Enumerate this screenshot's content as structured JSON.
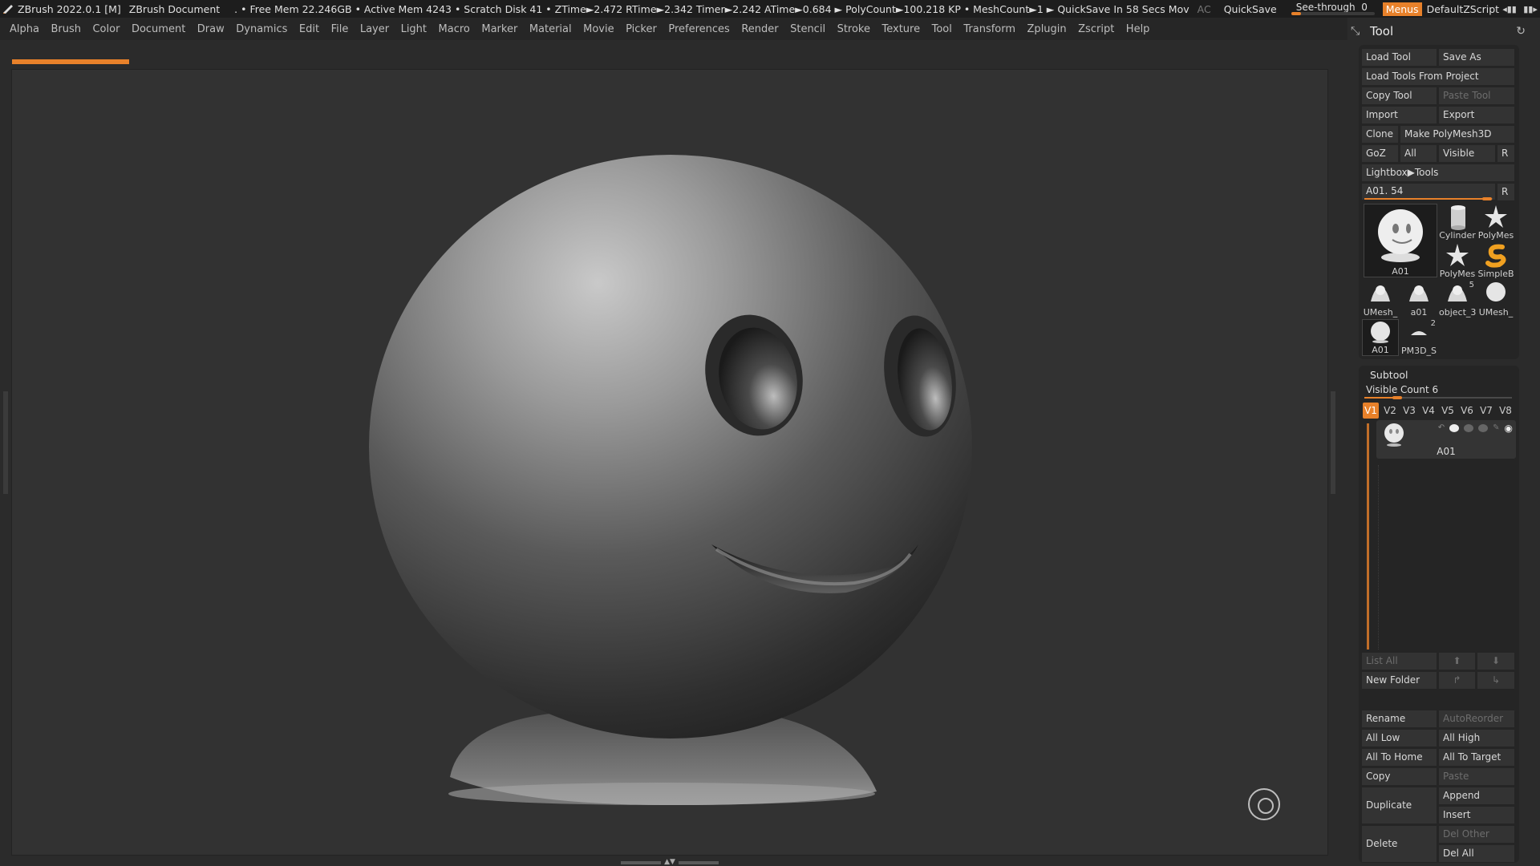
{
  "titlebar": {
    "app": "ZBrush 2022.0.1 [M]",
    "document": "ZBrush Document",
    "stats": ". • Free Mem 22.246GB • Active Mem 4243 • Scratch Disk 41 •  ZTime►2.472 RTime►2.342 Timer►2.242 ATime►0.684 ► PolyCount►100.218 KP  • MeshCount►1  ► QuickSave In 58 Secs Mov",
    "ac": "AC",
    "quicksave": "QuickSave",
    "seethrough_label": "See-through",
    "seethrough_value": "0",
    "menus": "Menus",
    "zscript": "DefaultZScript"
  },
  "menubar": {
    "items": [
      "Alpha",
      "Brush",
      "Color",
      "Document",
      "Draw",
      "Dynamics",
      "Edit",
      "File",
      "Layer",
      "Light",
      "Macro",
      "Marker",
      "Material",
      "Movie",
      "Picker",
      "Preferences",
      "Render",
      "Stencil",
      "Stroke",
      "Texture",
      "Tool",
      "Transform",
      "Zplugin",
      "Zscript",
      "Help"
    ]
  },
  "tool_panel": {
    "title": "Tool",
    "load_tool": "Load Tool",
    "save_as": "Save As",
    "load_from_project": "Load Tools From Project",
    "copy_tool": "Copy Tool",
    "paste_tool": "Paste Tool",
    "import": "Import",
    "export": "Export",
    "clone": "Clone",
    "make_polymesh": "Make PolyMesh3D",
    "goz": "GoZ",
    "all": "All",
    "visible": "Visible",
    "r": "R",
    "lightbox": "Lightbox▶Tools",
    "current_tool": "A01. 54",
    "current_r": "R",
    "thumbs": {
      "a01_big": "A01",
      "cylinder": "Cylinder",
      "polymesh1": "PolyMes",
      "polymesh2": "PolyMes",
      "simpleb": "SimpleB",
      "umesh1": "UMesh_",
      "a01_small": "a01",
      "object3": "object_3",
      "object3_badge": "5",
      "umesh2": "UMesh_",
      "a01_sel": "A01",
      "pm3d": "PM3D_S",
      "pm3d_badge": "2"
    }
  },
  "subtool": {
    "title": "Subtool",
    "visible_count": "Visible Count 6",
    "versions": [
      "V1",
      "V2",
      "V3",
      "V4",
      "V5",
      "V6",
      "V7",
      "V8"
    ],
    "item_name": "A01",
    "list_all": "List All",
    "new_folder": "New Folder",
    "rename": "Rename",
    "autoreorder": "AutoReorder",
    "all_low": "All Low",
    "all_high": "All High",
    "all_to_home": "All To Home",
    "all_to_target": "All To Target",
    "copy": "Copy",
    "paste": "Paste",
    "duplicate": "Duplicate",
    "append": "Append",
    "insert": "Insert",
    "delete": "Delete",
    "del_other": "Del Other",
    "del_all": "Del All"
  },
  "colors": {
    "accent": "#e8812a",
    "background": "#323232",
    "panel": "#252525",
    "button": "#333333"
  }
}
